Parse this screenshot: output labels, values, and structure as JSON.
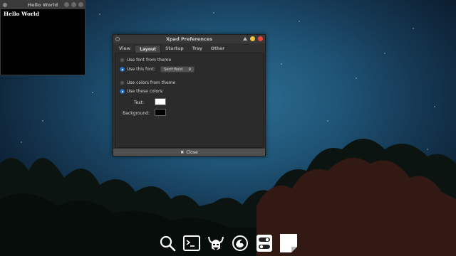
{
  "hello_window": {
    "title": "Hello World",
    "content": "Hello World"
  },
  "preferences": {
    "title": "Xpad Preferences",
    "tabs": [
      {
        "label": "View",
        "active": false
      },
      {
        "label": "Layout",
        "active": true
      },
      {
        "label": "Startup",
        "active": false
      },
      {
        "label": "Tray",
        "active": false
      },
      {
        "label": "Other",
        "active": false
      }
    ],
    "font": {
      "use_theme_label": "Use font from theme",
      "use_this_label": "Use this font:",
      "selected": "use_this",
      "font_name": "Serif Bold",
      "font_size": "9"
    },
    "colors": {
      "use_theme_label": "Use colors from theme",
      "use_these_label": "Use these colors:",
      "selected": "use_these",
      "text_label": "Text:",
      "text_color": "#ffffff",
      "background_label": "Background:",
      "background_color": "#000000"
    },
    "close_label": "Close",
    "accent_color": "#2f7de1"
  },
  "dock": {
    "items": [
      {
        "name": "search",
        "icon": "magnifier-icon"
      },
      {
        "name": "terminal",
        "icon": "terminal-icon"
      },
      {
        "name": "viking",
        "icon": "viking-helmet-icon"
      },
      {
        "name": "firefox",
        "icon": "firefox-icon"
      },
      {
        "name": "settings",
        "icon": "toggle-settings-icon"
      },
      {
        "name": "notes",
        "icon": "sticky-note-icon"
      }
    ]
  }
}
